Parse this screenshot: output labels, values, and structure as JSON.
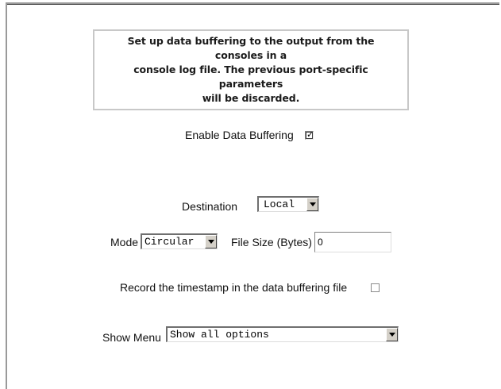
{
  "info": {
    "line1": "Set up data buffering to the output from the consoles in a",
    "line2": "console log file. The previous port-specific parameters",
    "line3": "will be discarded."
  },
  "enable_buffering": {
    "label": "Enable Data Buffering",
    "checked": true
  },
  "destination": {
    "label": "Destination",
    "value": "Local"
  },
  "mode": {
    "label": "Mode",
    "value": "Circular"
  },
  "file_size": {
    "label": "File Size (Bytes)",
    "value": "0"
  },
  "timestamp": {
    "label": "Record the timestamp in the data buffering file",
    "checked": false
  },
  "show_menu": {
    "label": "Show Menu",
    "value": "Show all options"
  },
  "icons": {
    "check": "checkmark-icon",
    "dropdown": "triangle-down-icon"
  }
}
